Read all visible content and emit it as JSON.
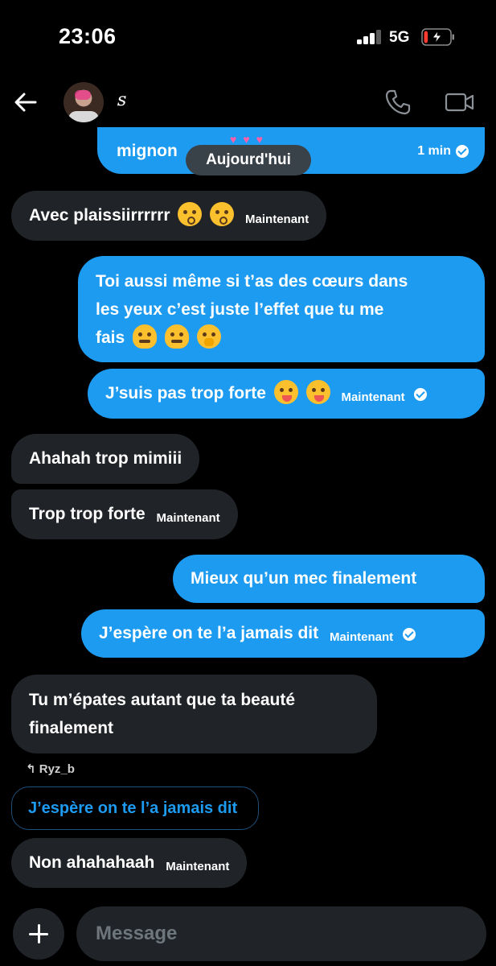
{
  "status_bar": {
    "time": "23:06",
    "network": "5G",
    "battery_level": 0.15,
    "charging": true
  },
  "header": {
    "contact_name": "ꜱ",
    "back_icon": "back-arrow-icon",
    "call_icon": "phone-icon",
    "video_icon": "video-camera-icon"
  },
  "date_separator": "Aujourd'hui",
  "messages": [
    {
      "direction": "sent",
      "text": "mignon",
      "meta": "1 min",
      "read": true
    },
    {
      "direction": "received",
      "text": "Avec plaissiirrrrrr",
      "emojis": [
        "kissing-face",
        "kissing-face"
      ],
      "meta": "Maintenant"
    },
    {
      "direction": "sent",
      "lines": [
        "Toi aussi même si t’as des cœurs dans",
        "les yeux c’est juste l’effet que tu me",
        "fais"
      ],
      "emojis": [
        "melting-face",
        "melting-face",
        "hand-over-mouth-face"
      ]
    },
    {
      "direction": "sent",
      "text": "J’suis pas trop forte",
      "emojis": [
        "zany-face",
        "zany-face"
      ],
      "meta": "Maintenant",
      "read": true
    },
    {
      "direction": "received",
      "text": "Ahahah trop mimiii"
    },
    {
      "direction": "received",
      "text": "Trop trop forte",
      "meta": "Maintenant"
    },
    {
      "direction": "sent",
      "text": "Mieux qu’un mec finalement"
    },
    {
      "direction": "sent",
      "text": "J’espère on te l’a jamais dit",
      "meta": "Maintenant",
      "read": true
    },
    {
      "direction": "received",
      "lines": [
        "Tu m’épates autant que ta beauté",
        "finalement"
      ]
    },
    {
      "direction": "received",
      "reply_to_user": "Ryz_b",
      "quoted_text": "J’espère on te l’a jamais dit",
      "text": "Non ahahahaah",
      "meta": "Maintenant"
    }
  ],
  "composer": {
    "placeholder": "Message"
  },
  "colors": {
    "sent_bubble": "#1d9bf0",
    "received_bubble": "#202327",
    "background": "#000000",
    "date_pill": "#3a4249"
  }
}
